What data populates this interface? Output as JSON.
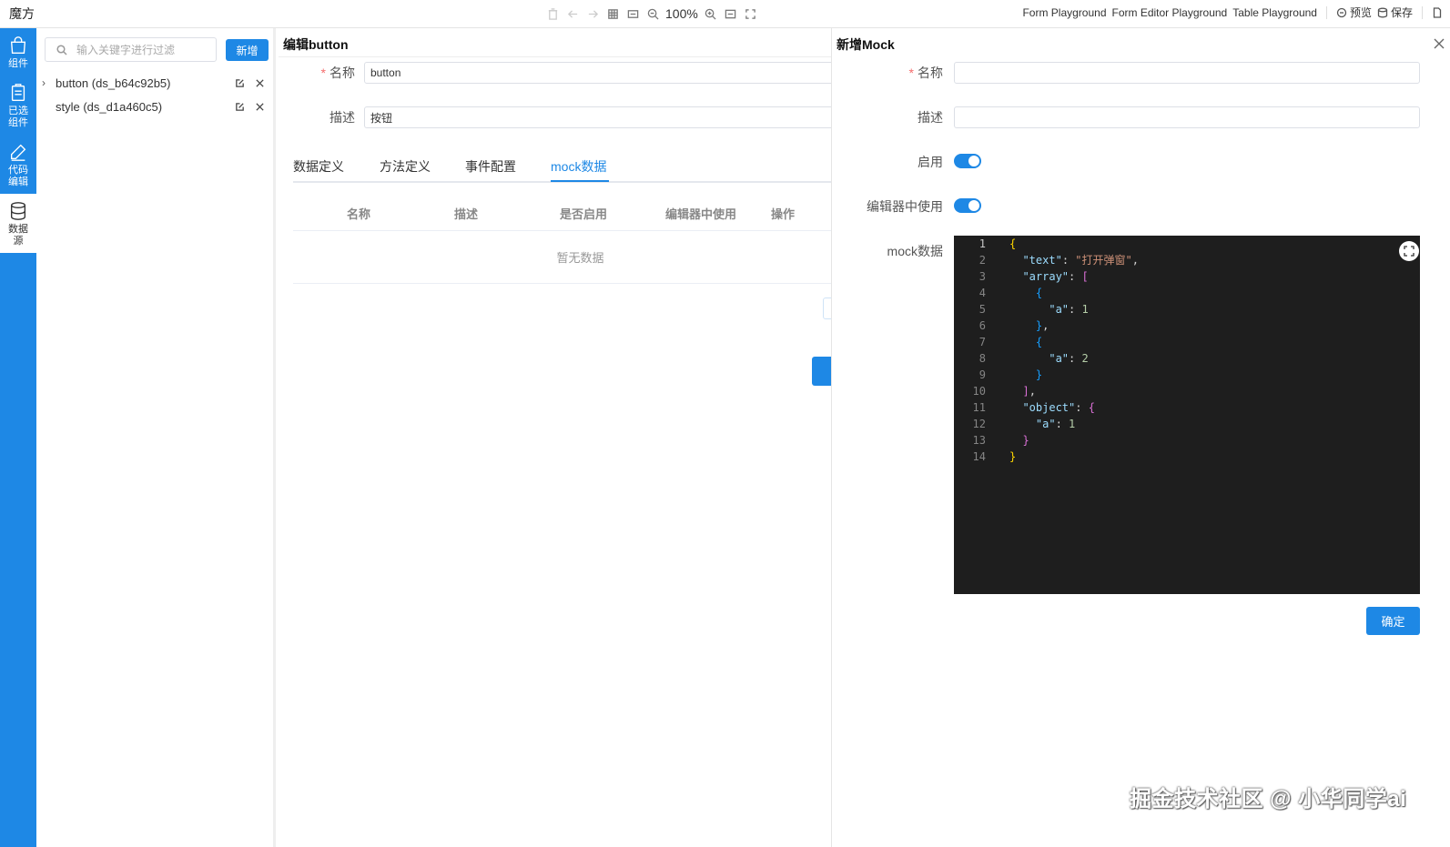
{
  "app": {
    "title": "魔方"
  },
  "toolbar": {
    "zoom": "100%"
  },
  "top_links": [
    "Form Playground",
    "Form Editor Playground",
    "Table Playground"
  ],
  "top_actions": {
    "preview": "预览",
    "save": "保存"
  },
  "nav": {
    "components": "组件",
    "selected_components": "已选组件",
    "code_edit": "代码编辑",
    "datasource": "数据源"
  },
  "datasource": {
    "search_placeholder": "输入关键字进行过滤",
    "add_label": "新增",
    "items": [
      {
        "label": "button (ds_b64c92b5)",
        "expandable": true
      },
      {
        "label": "style (ds_d1a460c5)",
        "expandable": false
      }
    ]
  },
  "editor": {
    "title": "编辑button",
    "name_label": "名称",
    "name_value": "button",
    "desc_label": "描述",
    "desc_value": "按钮",
    "tabs": [
      "数据定义",
      "方法定义",
      "事件配置",
      "mock数据"
    ],
    "active_tab": 3,
    "table_columns": [
      "名称",
      "描述",
      "是否启用",
      "编辑器中使用",
      "操作"
    ],
    "empty_text": "暂无数据"
  },
  "mock": {
    "title": "新增Mock",
    "name_label": "名称",
    "desc_label": "描述",
    "enable_label": "启用",
    "enable_on": true,
    "use_in_editor_label": "编辑器中使用",
    "use_in_editor_on": true,
    "data_label": "mock数据",
    "confirm_label": "确定",
    "code_lines": [
      "{",
      "  \"text\": \"打开弹窗\",",
      "  \"array\": [",
      "    {",
      "      \"a\": 1",
      "    },",
      "    {",
      "      \"a\": 2",
      "    }",
      "  ],",
      "  \"object\": {",
      "    \"a\": 1",
      "  }",
      "}"
    ]
  },
  "watermark": "掘金技术社区 @ 小华同学ai"
}
